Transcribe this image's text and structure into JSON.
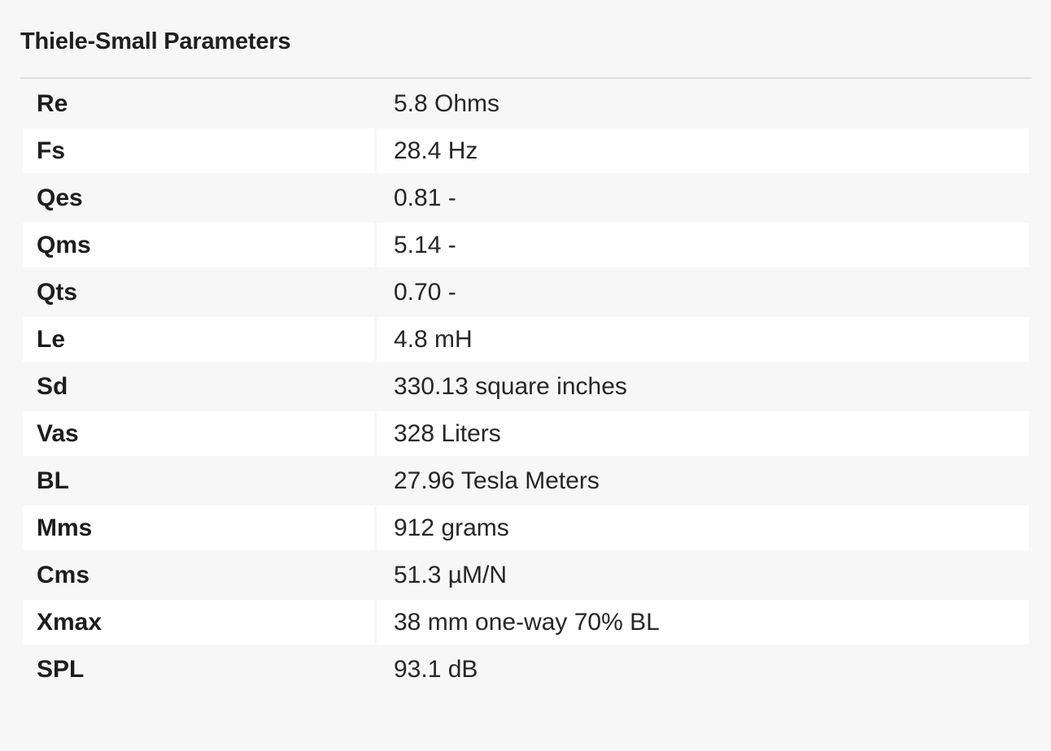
{
  "title": "Thiele-Small Parameters",
  "parameters": [
    {
      "name": "Re",
      "value": "5.8 Ohms"
    },
    {
      "name": "Fs",
      "value": "28.4 Hz"
    },
    {
      "name": "Qes",
      "value": "0.81 -"
    },
    {
      "name": "Qms",
      "value": "5.14 -"
    },
    {
      "name": "Qts",
      "value": "0.70 -"
    },
    {
      "name": "Le",
      "value": "4.8 mH"
    },
    {
      "name": "Sd",
      "value": "330.13 square inches"
    },
    {
      "name": "Vas",
      "value": "328 Liters"
    },
    {
      "name": "BL",
      "value": "27.96 Tesla Meters"
    },
    {
      "name": "Mms",
      "value": "912 grams"
    },
    {
      "name": "Cms",
      "value": "51.3 µM/N"
    },
    {
      "name": "Xmax",
      "value": "38 mm one-way 70% BL"
    },
    {
      "name": "SPL",
      "value": "93.1 dB"
    }
  ]
}
